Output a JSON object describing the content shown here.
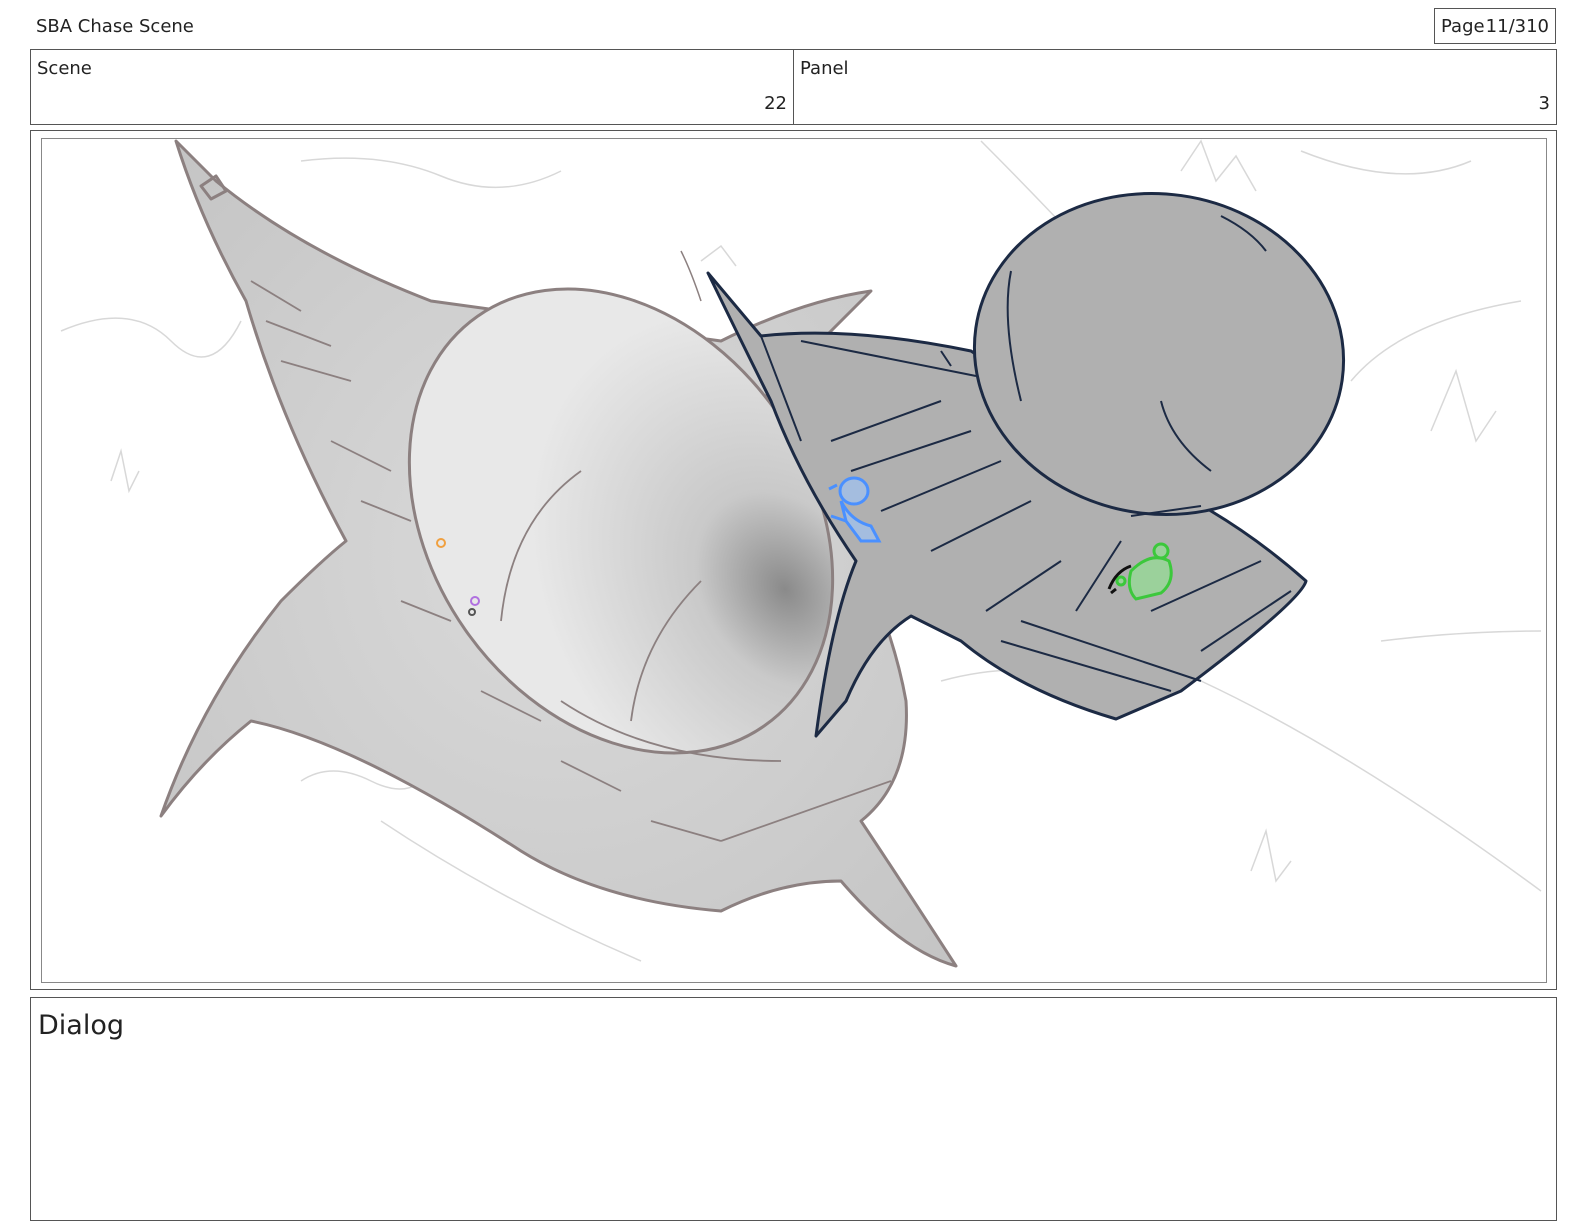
{
  "header": {
    "title": "SBA Chase Scene",
    "page_label": "Page",
    "page_value": "11/310"
  },
  "meta": {
    "scene_label": "Scene",
    "scene_value": "22",
    "panel_label": "Panel",
    "panel_value": "3"
  },
  "dialog": {
    "label": "Dialog",
    "text": ""
  },
  "colors": {
    "border": "#555555",
    "ship_fill": "#b0b0b0",
    "ship_stroke": "#1c2a44",
    "shark_stroke": "#8c8080",
    "blue_character": "#4a90ff",
    "green_character": "#3cc83c"
  }
}
